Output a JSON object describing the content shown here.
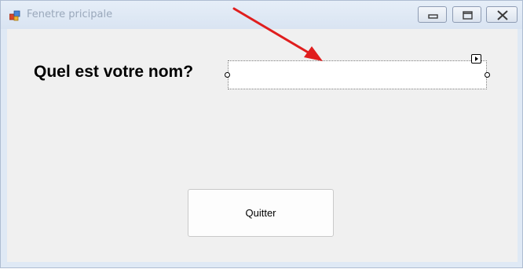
{
  "window": {
    "title": "Fenetre pricipale"
  },
  "form": {
    "prompt_label": "Quel est votre nom?",
    "name_value": "",
    "quit_label": "Quitter"
  },
  "icons": {
    "app": "windows-form-icon",
    "minimize": "minimize-icon",
    "maximize": "maximize-icon",
    "close": "close-icon",
    "smart_tag": "smart-tag-arrow-icon",
    "annotation": "red-arrow-annotation"
  },
  "colors": {
    "annotation_arrow": "#e01e1e",
    "client_background": "#f0f0f0",
    "title_text": "#9aa8bb"
  }
}
